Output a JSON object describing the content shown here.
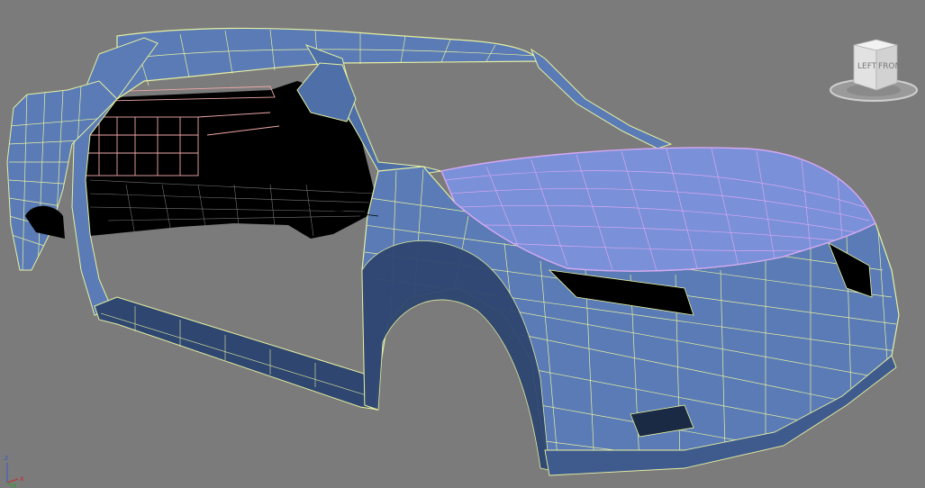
{
  "viewport": {
    "background_color": "#7b7b7b"
  },
  "model": {
    "body_color": "#5a7bb5",
    "body_dark_color": "#3f5b8e",
    "wire_color": "#e6f0a0",
    "hood_color": "#7a90d8",
    "hood_wire_color": "#d7a8f5",
    "interior_wire_color": "#f0a8a8",
    "interior_color": "#000000"
  },
  "viewcube": {
    "left_label": "LEFT",
    "front_label": "FRONT",
    "icon": "viewcube-icon"
  },
  "axis_tripod": {
    "z_label": "z",
    "y_label": "y",
    "x_label": "x",
    "icon": "axis-tripod-icon"
  }
}
